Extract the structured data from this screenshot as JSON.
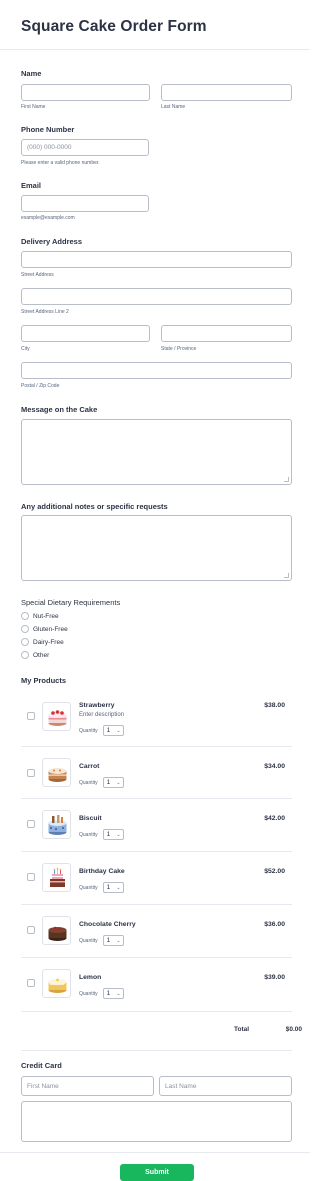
{
  "form_title": "Square Cake Order Form",
  "name": {
    "label": "Name",
    "first_sub": "First Name",
    "last_sub": "Last Name"
  },
  "phone": {
    "label": "Phone Number",
    "placeholder": "(000) 000-0000",
    "sub": "Please enter a valid phone number."
  },
  "email": {
    "label": "Email",
    "sub": "example@example.com"
  },
  "address": {
    "label": "Delivery Address",
    "street": "Street Address",
    "street2": "Street Address Line 2",
    "city": "City",
    "state": "State / Province",
    "zip": "Postal / Zip Code"
  },
  "message": {
    "label": "Message on the Cake"
  },
  "notes": {
    "label": "Any additional notes or specific requests"
  },
  "dietary": {
    "label": "Special Dietary Requirements",
    "options": [
      "Nut-Free",
      "Gluten-Free",
      "Dairy-Free",
      "Other"
    ]
  },
  "products": {
    "label": "My Products",
    "quantity_label": "Quantity",
    "items": [
      {
        "name": "Strawberry",
        "description": "Enter description",
        "price": "$38.00",
        "qty": "1",
        "icon": "strawberry-cake-icon"
      },
      {
        "name": "Carrot",
        "price": "$34.00",
        "qty": "1",
        "icon": "carrot-cake-icon"
      },
      {
        "name": "Biscuit",
        "price": "$42.00",
        "qty": "1",
        "icon": "biscuit-cake-icon"
      },
      {
        "name": "Birthday Cake",
        "price": "$52.00",
        "qty": "1",
        "icon": "birthday-cake-icon"
      },
      {
        "name": "Chocolate Cherry",
        "price": "$36.00",
        "qty": "1",
        "icon": "chocolate-cake-icon"
      },
      {
        "name": "Lemon",
        "price": "$39.00",
        "qty": "1",
        "icon": "lemon-cake-icon"
      }
    ],
    "total_label": "Total",
    "total_value": "$0.00"
  },
  "credit_card": {
    "label": "Credit Card",
    "first_placeholder": "First Name",
    "last_placeholder": "Last Name"
  },
  "submit_label": "Submit",
  "colors": {
    "accent": "#18b75e",
    "text": "#2c3345",
    "border": "#b8bdc9"
  }
}
